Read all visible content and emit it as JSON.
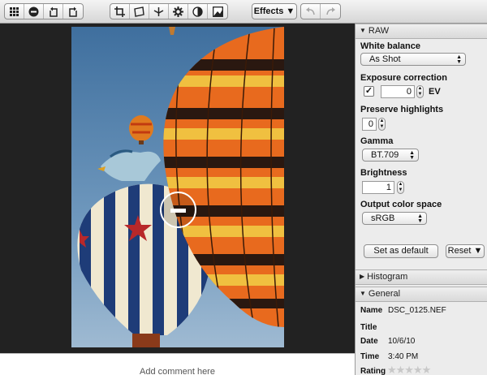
{
  "toolbar": {
    "group1": [
      "grid-icon",
      "minus-circle-icon",
      "rotate-left-icon",
      "rotate-right-icon"
    ],
    "group2": [
      "crop-icon",
      "straighten-icon",
      "level-icon",
      "settings-gear-icon",
      "contrast-icon",
      "histogram-image-icon"
    ],
    "effects_label": "Effects ▼",
    "undo_disabled": true,
    "redo_disabled": true
  },
  "canvas": {
    "comment_placeholder": "Add comment here"
  },
  "raw": {
    "header": "RAW",
    "white_balance_label": "White balance",
    "white_balance_value": "As Shot",
    "exposure_label": "Exposure correction",
    "exposure_checked": "✓",
    "exposure_value": "0",
    "exposure_unit": "EV",
    "highlights_label": "Preserve highlights",
    "highlights_value": "0",
    "gamma_label": "Gamma",
    "gamma_value": "BT.709",
    "brightness_label": "Brightness",
    "brightness_value": "1",
    "color_space_label": "Output color space",
    "color_space_value": "sRGB",
    "set_default_label": "Set as default",
    "reset_label": "Reset ▼"
  },
  "histogram": {
    "header": "Histogram"
  },
  "general": {
    "header": "General",
    "name_label": "Name",
    "name_value": "DSC_0125.NEF",
    "title_label": "Title",
    "title_value": "",
    "date_label": "Date",
    "date_value": "10/6/10",
    "time_label": "Time",
    "time_value": "3:40 PM",
    "rating_label": "Rating",
    "rating_value": 0,
    "rating_stars": "★★★★★"
  }
}
